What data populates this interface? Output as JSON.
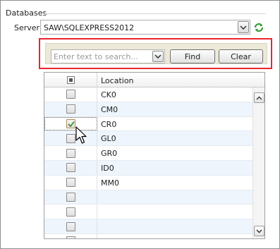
{
  "group": {
    "title": "Databases"
  },
  "server": {
    "label": "Server:",
    "value": "SAW\\SQLEXPRESS2012"
  },
  "search": {
    "placeholder": "Enter text to search...",
    "find_label": "Find",
    "clear_label": "Clear"
  },
  "grid": {
    "columns": [
      "",
      "Location"
    ],
    "rows": [
      {
        "location": "CK0",
        "checked": false
      },
      {
        "location": "CM0",
        "checked": false
      },
      {
        "location": "CR0",
        "checked": true
      },
      {
        "location": "GL0",
        "checked": false
      },
      {
        "location": "GR0",
        "checked": false
      },
      {
        "location": "ID0",
        "checked": false
      },
      {
        "location": "MM0",
        "checked": false
      },
      {
        "location": "",
        "checked": false
      },
      {
        "location": "",
        "checked": false
      },
      {
        "location": "",
        "checked": false
      },
      {
        "location": "",
        "checked": false
      }
    ]
  },
  "colors": {
    "highlight_border": "#e8262c",
    "alt_row": "#eef5fc",
    "check": "#2f8a2f"
  },
  "icons": [
    "chevron-down-icon",
    "refresh-icon",
    "checkmark-icon",
    "scroll-up-icon",
    "scroll-down-icon",
    "mouse-cursor-icon"
  ]
}
